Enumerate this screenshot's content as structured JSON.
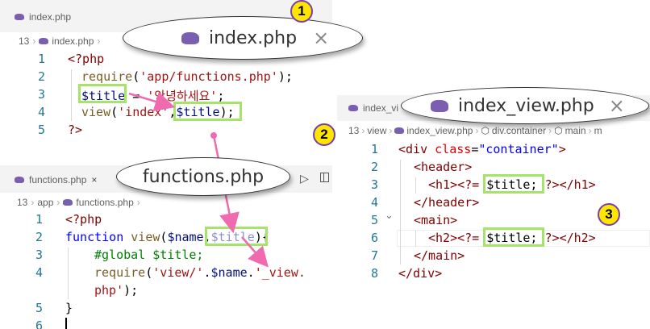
{
  "panes": {
    "index": {
      "tab_label": "index.php",
      "breadcrumb": [
        "13",
        "index.php"
      ],
      "line_numbers": [
        "1",
        "2",
        "3",
        "4",
        "5"
      ],
      "bubble_title": "index.php"
    },
    "functions": {
      "tab_label": "functions.php",
      "breadcrumb": [
        "13",
        "app",
        "functions.php"
      ],
      "line_numbers": [
        "1",
        "2",
        "3",
        "4",
        "",
        "5",
        "6"
      ],
      "bubble_title": "functions.php"
    },
    "index_view": {
      "tab_label": "index_vi",
      "breadcrumb": [
        "13",
        "view",
        "index_view.php",
        "div.container",
        "main",
        "m"
      ],
      "line_numbers": [
        "1",
        "2",
        "3",
        "4",
        "5",
        "6",
        "7",
        "8"
      ],
      "bubble_title": "index_view.php"
    }
  },
  "code": {
    "index": {
      "l1": "<?php",
      "l2_fn": "require",
      "l2_open": "(",
      "l2_str": "'app/functions.php'",
      "l2_close": ");",
      "l3_var": "$title",
      "l3_eq": " = ",
      "l3_str": "'안녕하세요'",
      "l3_end": ";",
      "l4_fn": "view",
      "l4_open": "(",
      "l4_str": "'index'",
      "l4_comma": ",",
      "l4_var": "$title",
      "l4_close": ");",
      "l5": "?>"
    },
    "functions": {
      "l1": "<?php",
      "l2_kw": "function",
      "l2_fn": " view",
      "l2_open": "(",
      "l2_var1": "$name",
      "l2_comma": ",",
      "l2_var2": "$title",
      "l2_close": "){",
      "l3": "#global $title;",
      "l4_fn": "require",
      "l4_open": "(",
      "l4_str": "'view/'",
      "l4_dot": ".",
      "l4_var": "$name",
      "l4_dot2": ".",
      "l4_str2": "'_view.",
      "l4b_str": "php'",
      "l4b_close": ");",
      "l5": "}"
    },
    "index_view": {
      "l1_tag": "<div",
      "l1_attr": " class",
      "l1_eq": "=",
      "l1_val": "\"container\"",
      "l1_end": ">",
      "l2": "<header>",
      "l3_open": "<h1>",
      "l3_php": "<?=",
      "l3_var": " $title;",
      "l3_end": " ?>",
      "l3_close": "</h1>",
      "l4": "</header>",
      "l5": "<main>",
      "l6_open": "<h2>",
      "l6_php": "<?=",
      "l6_var": " $title;",
      "l6_end": " ?>",
      "l6_close": "</h2>",
      "l7": "</main>",
      "l8": "</div>"
    }
  },
  "badges": [
    "1",
    "2",
    "3"
  ],
  "icons": {
    "close": "×",
    "php_file": "elephant-icon",
    "chevron": "›",
    "fold": "⌄"
  },
  "colors": {
    "highlight": "#a6e36a",
    "arrow": "#f06ab0",
    "badge_fill": "#ffe600",
    "badge_border": "#7a3ea8"
  }
}
